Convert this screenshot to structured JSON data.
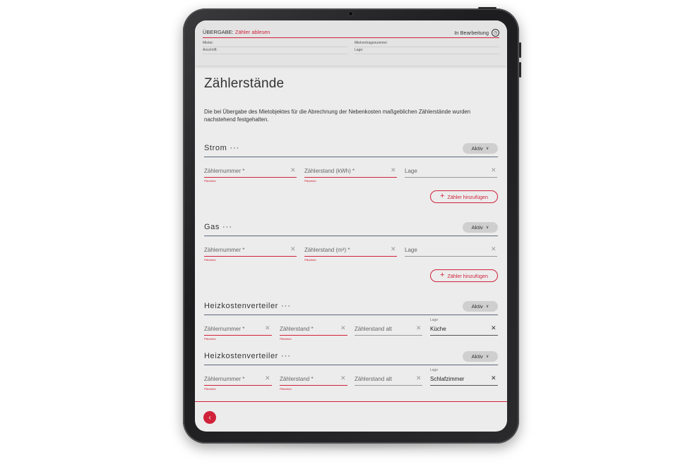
{
  "header": {
    "prefix": "ÜBERGABE:",
    "action": "Zähler ablesen",
    "status": "In Bearbeitung",
    "status_icon": "progress-icon",
    "mieter_label": "Mieter:",
    "anschrift_label": "Anschrift:",
    "mietvertrag_label": "Mietvertragsnummer:",
    "lage_label": "Lage:"
  },
  "page": {
    "title": "Zählerstände",
    "intro": "Die bei Übergabe des Mietobjektes für die Abrechnung der Nebenkosten maßgeblichen Zählerstände wurden nachstehend festgehalten."
  },
  "sections": [
    {
      "title": "Strom",
      "dots": "···",
      "status": "Aktiv",
      "fields": {
        "nummer_placeholder": "Zählernummer *",
        "stand_placeholder": "Zählerstand  (kWh) *",
        "lage_placeholder": "Lage",
        "hint": "Pflichtfeld"
      },
      "add_button": "Zähler hinzufügen"
    },
    {
      "title": "Gas",
      "dots": "···",
      "status": "Aktiv",
      "fields": {
        "nummer_placeholder": "Zählernummer *",
        "stand_placeholder": "Zählerstand  (m³) *",
        "lage_placeholder": "Lage",
        "hint": "Pflichtfeld"
      },
      "add_button": "Zähler hinzufügen"
    },
    {
      "title": "Heizkostenverteiler",
      "dots": "···",
      "status": "Aktiv",
      "fields": {
        "nummer_placeholder": "Zählernummer *",
        "stand_placeholder": "Zählerstand  *",
        "alt_placeholder": "Zählerstand alt",
        "lage_label": "Lage",
        "lage_value": "Küche",
        "hint": "Pflichtfeld"
      }
    },
    {
      "title": "Heizkostenverteiler",
      "dots": "···",
      "status": "Aktiv",
      "fields": {
        "nummer_placeholder": "Zählernummer *",
        "stand_placeholder": "Zählerstand  *",
        "alt_placeholder": "Zählerstand alt",
        "lage_label": "Lage",
        "lage_value": "Schlafzimmer",
        "hint": "Pflichtfeld"
      }
    }
  ],
  "footer": {
    "back_icon": "chevron-left-icon"
  },
  "colors": {
    "accent": "#d0223a",
    "divider": "#5a6878",
    "screen_bg": "#ececec",
    "chip_bg": "#cfcfcf"
  }
}
